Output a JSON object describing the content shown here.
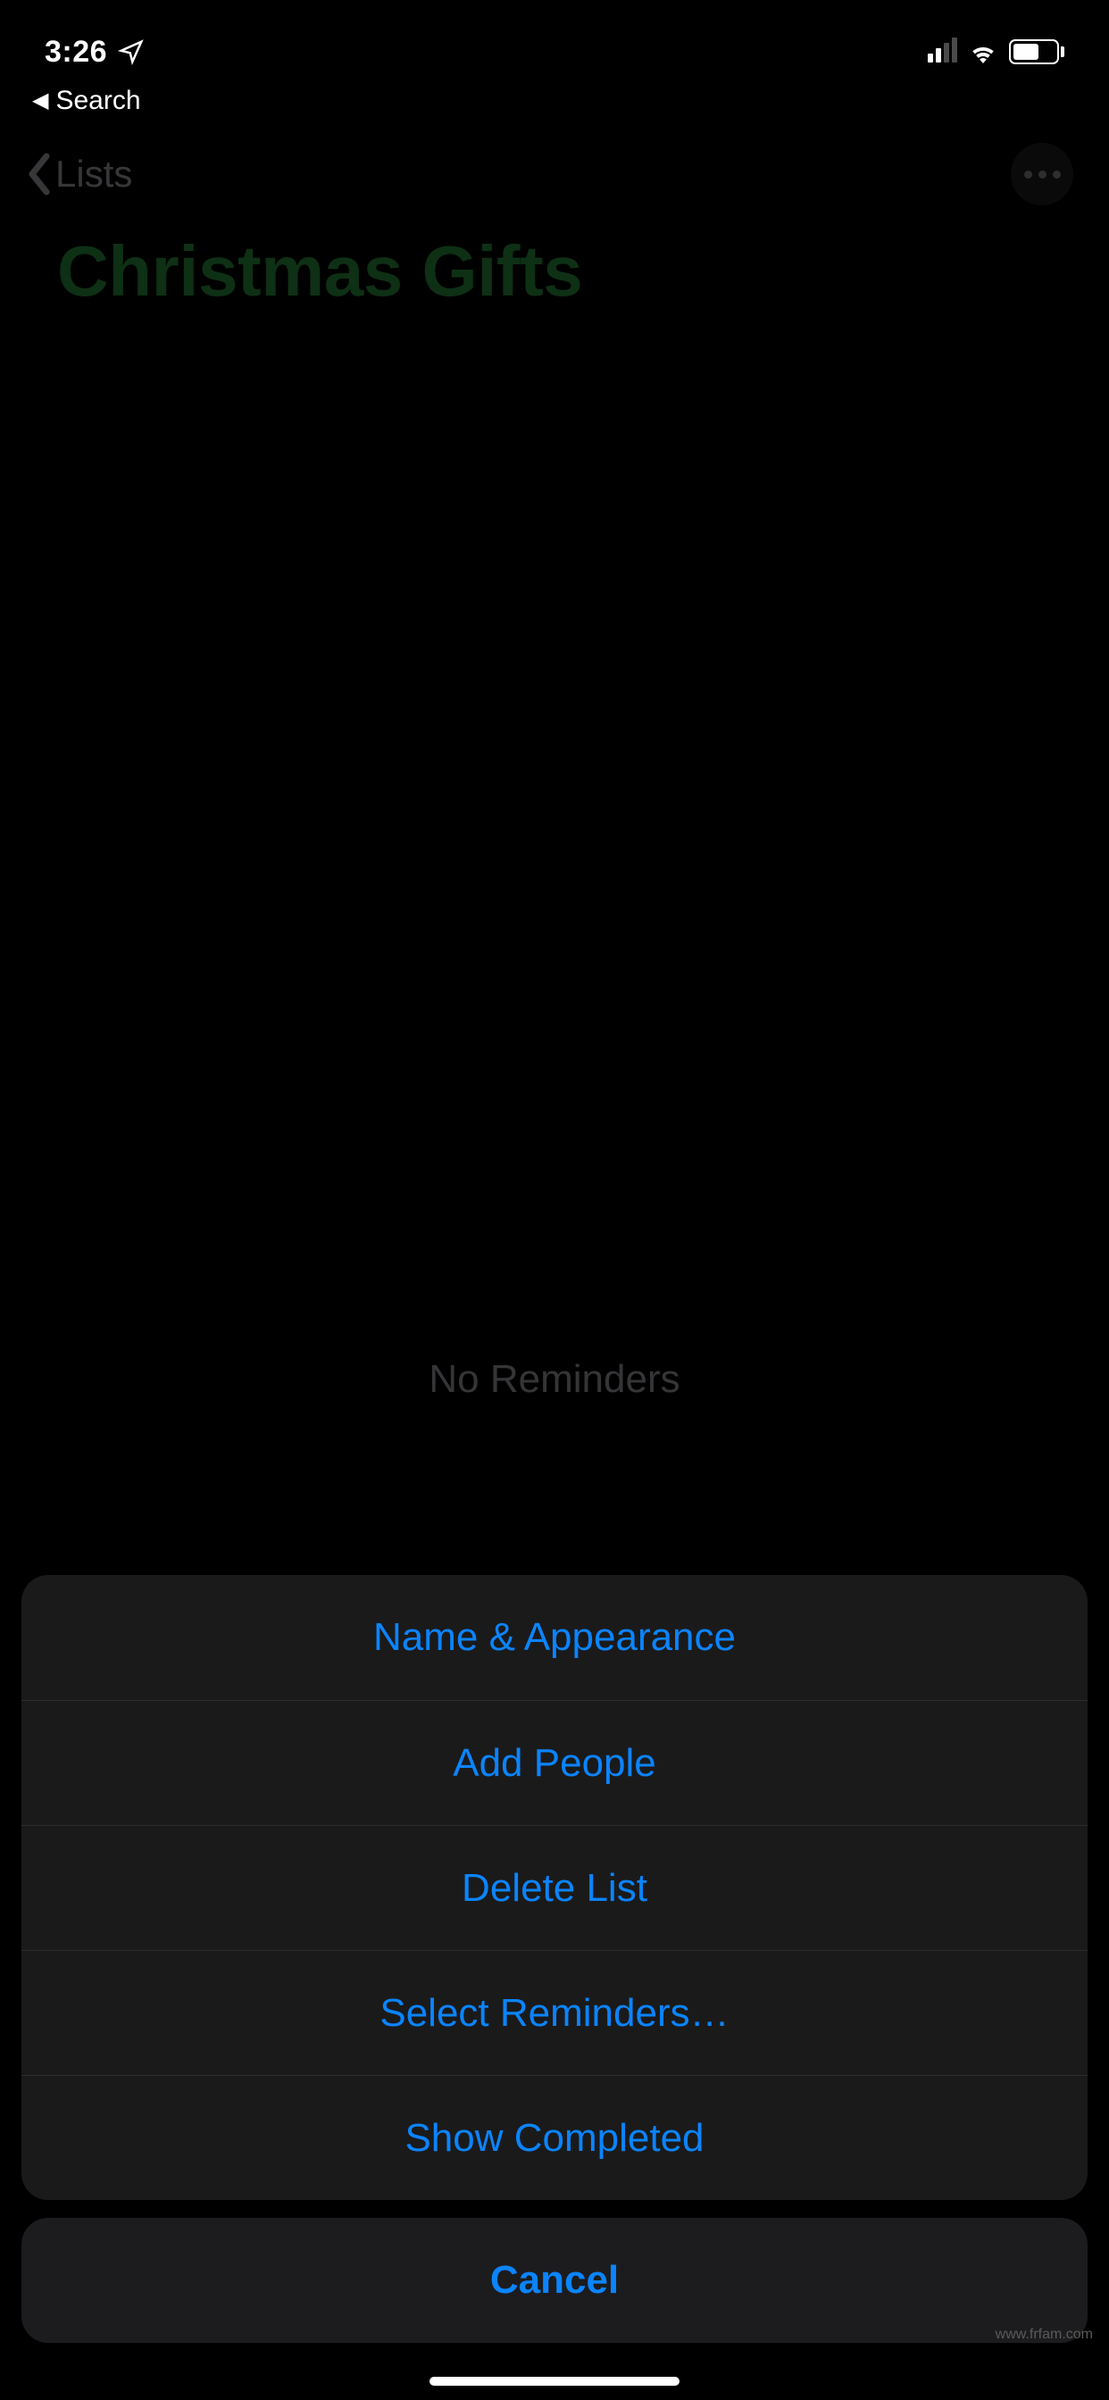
{
  "status_bar": {
    "time": "3:26"
  },
  "breadcrumb": {
    "label": "Search"
  },
  "nav": {
    "back_label": "Lists"
  },
  "list": {
    "title": "Christmas Gifts",
    "empty_text": "No Reminders"
  },
  "action_sheet": {
    "items": [
      "Name & Appearance",
      "Add People",
      "Delete List",
      "Select Reminders…",
      "Show Completed"
    ],
    "cancel": "Cancel"
  },
  "watermark": "www.frfam.com"
}
